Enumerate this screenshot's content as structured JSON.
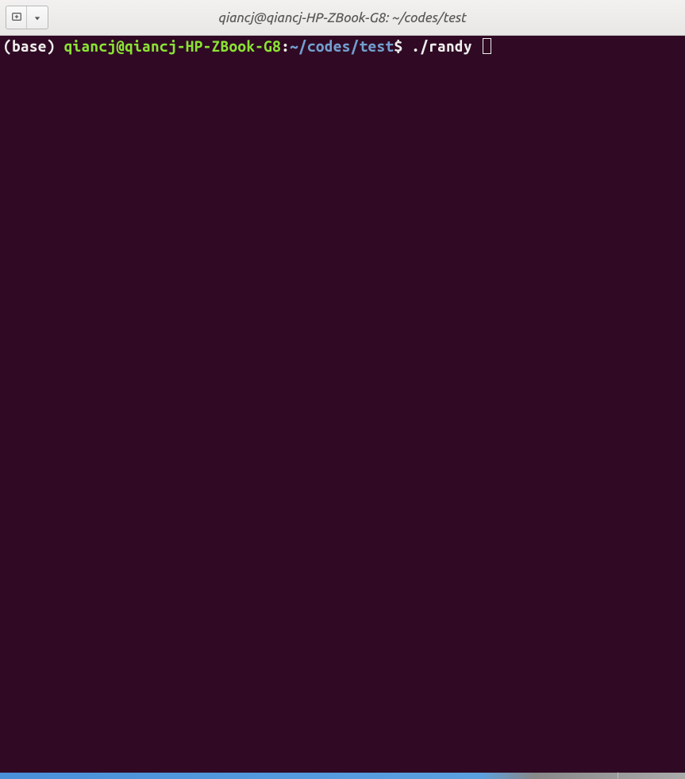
{
  "titlebar": {
    "title": "qiancj@qiancj-HP-ZBook-G8: ~/codes/test"
  },
  "prompt": {
    "env": "(base) ",
    "userhost": "qiancj@qiancj-HP-ZBook-G8",
    "colon": ":",
    "path": "~/codes/test",
    "dollar": "$",
    "command": " ./randy "
  }
}
